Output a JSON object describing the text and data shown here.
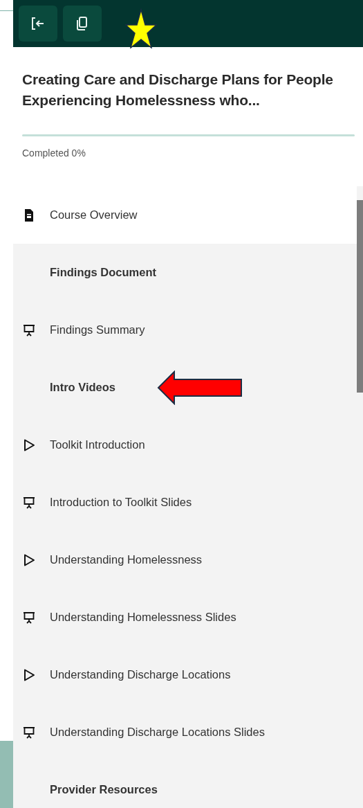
{
  "toolbar": {
    "buttons": [
      {
        "kind": "exit"
      },
      {
        "kind": "copy"
      }
    ]
  },
  "course": {
    "title": "Creating Care and Discharge Plans for People Experiencing Homelessness who...",
    "progress": {
      "level": 0,
      "label": "Completed 0%"
    }
  },
  "outline": [
    {
      "kind": "document",
      "label": "Course Overview",
      "selected": true
    },
    {
      "kind": "section",
      "label": "Findings Document",
      "arrow": false
    },
    {
      "kind": "slides",
      "label": "Findings Summary",
      "selected": false
    },
    {
      "kind": "section",
      "label": "Intro Videos",
      "arrow": true
    },
    {
      "kind": "video",
      "label": "Toolkit Introduction",
      "selected": false
    },
    {
      "kind": "slides",
      "label": "Introduction to Toolkit Slides",
      "selected": false
    },
    {
      "kind": "video",
      "label": "Understanding Homelessness",
      "selected": false
    },
    {
      "kind": "slides",
      "label": "Understanding Homelessness Slides",
      "selected": false
    },
    {
      "kind": "video",
      "label": "Understanding Discharge Locations",
      "selected": false
    },
    {
      "kind": "slides",
      "label": "Understanding Discharge Locations Slides",
      "selected": false
    },
    {
      "kind": "section",
      "label": "Provider Resources",
      "arrow": false
    }
  ],
  "star": true
}
